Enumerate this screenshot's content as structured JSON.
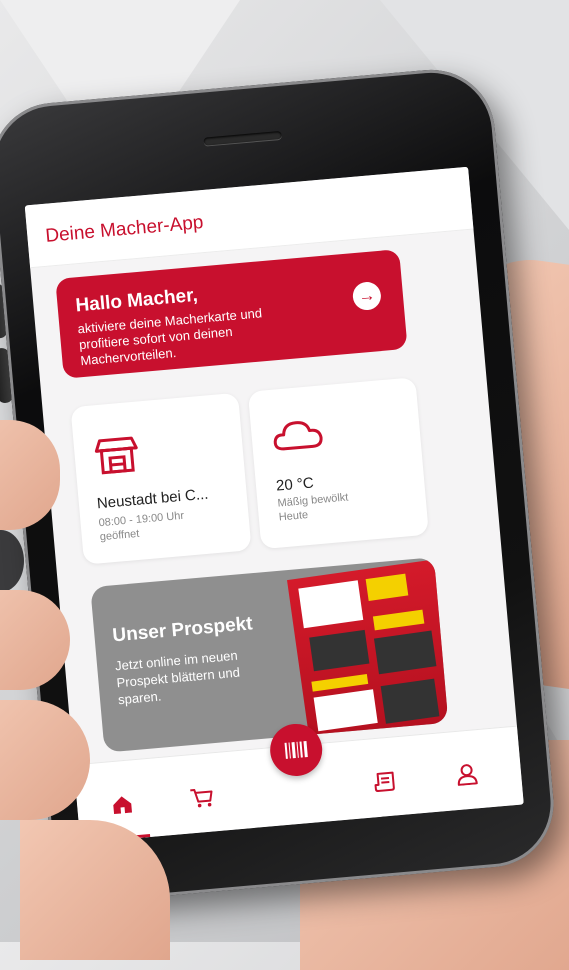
{
  "app": {
    "title": "Deine Macher-App"
  },
  "hero": {
    "title": "Hallo Macher,",
    "text": "aktiviere deine Macherkarte und profitiere sofort von deinen Machervorteilen.",
    "arrow_icon": "arrow-right-icon"
  },
  "store": {
    "icon": "store-icon",
    "name": "Neustadt bei C...",
    "hours": "08:00 - 19:00 Uhr",
    "status": "geöffnet"
  },
  "weather": {
    "icon": "cloud-icon",
    "temperature": "20 °C",
    "description": "Mäßig bewölkt",
    "day": "Heute"
  },
  "prospekt": {
    "title": "Unser Prospekt",
    "text": "Jetzt online im neuen Prospekt blättern und sparen."
  },
  "nav": {
    "items": [
      {
        "icon": "home-icon",
        "active": true
      },
      {
        "icon": "cart-icon",
        "active": false
      },
      {
        "icon": "barcode-icon",
        "active": false
      },
      {
        "icon": "receipt-icon",
        "active": false
      },
      {
        "icon": "user-icon",
        "active": false
      }
    ]
  },
  "colors": {
    "brand_red": "#c8102e",
    "card_grey": "#8f8f8f",
    "screen_bg": "#f5f4f5"
  }
}
